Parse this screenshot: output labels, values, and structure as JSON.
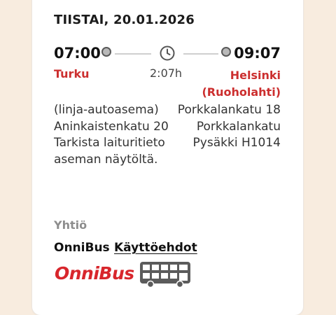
{
  "trip": {
    "date": "TIISTAI, 20.01.2026",
    "departure": {
      "time": "07:00",
      "city": "Turku",
      "address": "(linja-autoasema) Aninkaistenkatu 20 Tarkista laituritieto aseman näytöltä."
    },
    "arrival": {
      "time": "09:07",
      "city": "Helsinki (Ruoholahti)",
      "address": "Porkkalankatu 18 Porkkalankatu Pysäkki H1014"
    },
    "duration": "2:07h"
  },
  "company": {
    "heading": "Yhtiö",
    "name": "OnniBus",
    "terms_link": "Käyttöehdot",
    "logo_text": "OnniBus"
  },
  "colors": {
    "accent": "#cc2f2f",
    "logo": "#d8262c",
    "background": "#f8ecdf"
  },
  "icons": [
    "clock-icon",
    "bus-icon"
  ]
}
